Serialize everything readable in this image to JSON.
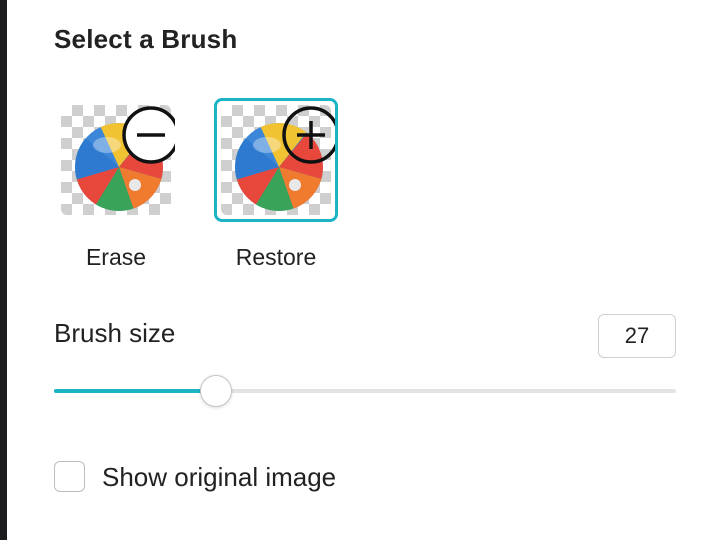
{
  "panel": {
    "title": "Select a Brush",
    "brushes": [
      {
        "label": "Erase",
        "icon": "minus-circle-icon",
        "selected": false
      },
      {
        "label": "Restore",
        "icon": "plus-circle-icon",
        "selected": true
      }
    ],
    "brush_size": {
      "label": "Brush size",
      "value": "27",
      "fraction": 0.26
    },
    "show_original": {
      "label": "Show original image",
      "checked": false
    }
  },
  "colors": {
    "accent": "#1bb4c4",
    "track": "#e3e3e3",
    "text": "#222222"
  }
}
